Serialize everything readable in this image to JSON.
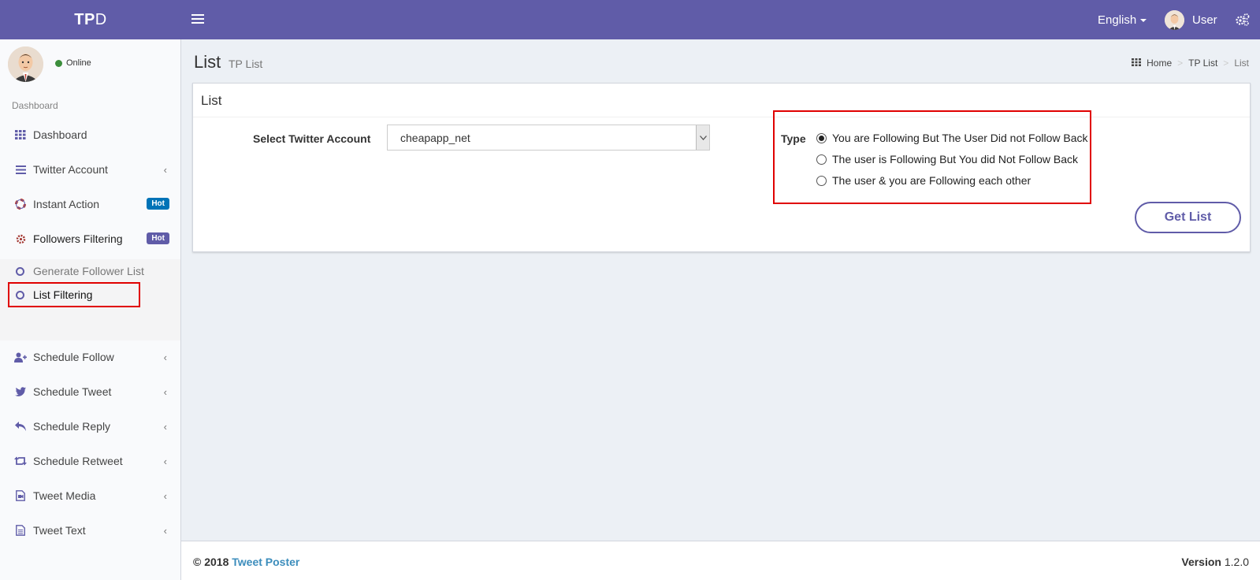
{
  "header": {
    "logo_bold": "TP",
    "logo_rest": "D",
    "language": "English",
    "user_name": "User"
  },
  "sidebar": {
    "status": "Online",
    "section_header": "Dashboard",
    "items": [
      {
        "label": "Dashboard",
        "icon": "grid-icon"
      },
      {
        "label": "Twitter Account",
        "icon": "list-icon"
      },
      {
        "label": "Instant Action",
        "icon": "lifebuoy-icon",
        "badge": "Hot"
      },
      {
        "label": "Followers Filtering",
        "icon": "gear-icon",
        "badge": "Hot"
      },
      {
        "label": "Schedule Follow",
        "icon": "user-plus-icon"
      },
      {
        "label": "Schedule Tweet",
        "icon": "twitter-icon"
      },
      {
        "label": "Schedule Reply",
        "icon": "reply-icon"
      },
      {
        "label": "Schedule Retweet",
        "icon": "retweet-icon"
      },
      {
        "label": "Tweet Media",
        "icon": "media-file-icon"
      },
      {
        "label": "Tweet Text",
        "icon": "text-file-icon"
      }
    ],
    "submenu": [
      {
        "label": "Generate Follower List"
      },
      {
        "label": "List Filtering"
      }
    ]
  },
  "page": {
    "title": "List",
    "subtitle": "TP List",
    "breadcrumb": [
      "Home",
      "TP List",
      "List"
    ]
  },
  "box": {
    "title": "List",
    "account_label": "Select Twitter Account",
    "account_value": "cheapapp_net",
    "type_label": "Type",
    "options": [
      {
        "label": "You are Following But The User Did not Follow Back",
        "selected": true
      },
      {
        "label": "The user is Following But You did Not Follow Back",
        "selected": false
      },
      {
        "label": "The user & you are Following each other",
        "selected": false
      }
    ],
    "button": "Get List"
  },
  "footer": {
    "copyright": "© 2018",
    "brand": "Tweet Poster",
    "version_label": "Version",
    "version": "1.2.0"
  },
  "colors": {
    "brand": "#605ca8",
    "highlight": "#e00000"
  }
}
